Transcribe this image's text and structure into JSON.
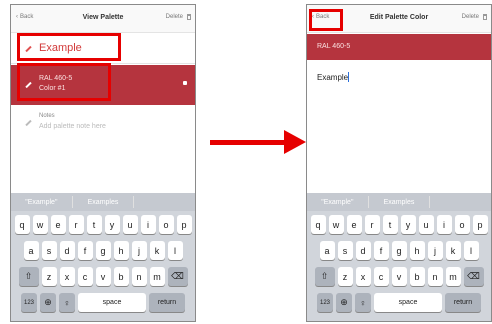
{
  "left": {
    "nav": {
      "back": "Back",
      "title": "View Palette",
      "delete": "Delete"
    },
    "name_value": "Example",
    "color_code": "RAL 460-5",
    "color_name": "Color #1",
    "note_label": "Notes",
    "note_placeholder": "Add palette note here",
    "suggestions": [
      "\"Example\"",
      "Examples"
    ]
  },
  "right": {
    "nav": {
      "back": "Back",
      "title": "Edit Palette Color",
      "delete": "Delete"
    },
    "color_code": "RAL 460-5",
    "input_value": "Example",
    "suggestions": [
      "\"Example\"",
      "Examples"
    ]
  },
  "keyboard": {
    "row1": [
      "q",
      "w",
      "e",
      "r",
      "t",
      "y",
      "u",
      "i",
      "o",
      "p"
    ],
    "row2": [
      "a",
      "s",
      "d",
      "f",
      "g",
      "h",
      "j",
      "k",
      "l"
    ],
    "row3": [
      "z",
      "x",
      "c",
      "v",
      "b",
      "n",
      "m"
    ],
    "num": "123",
    "space": "space",
    "return": "return"
  },
  "colors": {
    "accent": "#b5343e",
    "highlight": "#e60000"
  }
}
